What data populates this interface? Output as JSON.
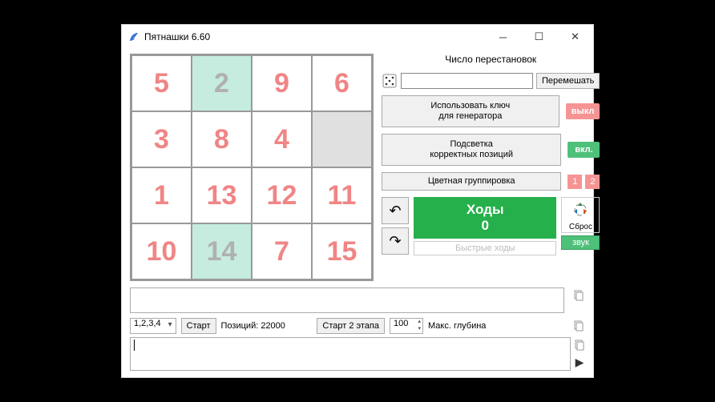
{
  "window": {
    "title": "Пятнашки 6.60"
  },
  "board": {
    "tiles": [
      {
        "v": "5",
        "cls": "red"
      },
      {
        "v": "2",
        "cls": "green-bg"
      },
      {
        "v": "9",
        "cls": "red"
      },
      {
        "v": "6",
        "cls": "red"
      },
      {
        "v": "3",
        "cls": "red"
      },
      {
        "v": "8",
        "cls": "red"
      },
      {
        "v": "4",
        "cls": "red"
      },
      {
        "v": "",
        "cls": "empty"
      },
      {
        "v": "1",
        "cls": "red"
      },
      {
        "v": "13",
        "cls": "red"
      },
      {
        "v": "12",
        "cls": "red"
      },
      {
        "v": "11",
        "cls": "red"
      },
      {
        "v": "10",
        "cls": "red"
      },
      {
        "v": "14",
        "cls": "green-bg"
      },
      {
        "v": "7",
        "cls": "red"
      },
      {
        "v": "15",
        "cls": "red"
      }
    ]
  },
  "rpanel": {
    "perm_label": "Число перестановок",
    "perm_value": "",
    "perm_placeholder": "",
    "shuffle_btn": "Перемешать",
    "use_key_btn": "Использовать ключ\nдля генератора",
    "off_label": "выкл",
    "highlight_btn": "Подсветка\nкорректных позиций",
    "on_label": "вкл.",
    "color_group_btn": "Цветная группировка",
    "group1": "1",
    "group2": "2",
    "moves_label": "Ходы",
    "moves_count": "0",
    "fast_moves": "Быстрые ходы",
    "reset_label": "Сброс",
    "sound_label": "звук"
  },
  "bottom": {
    "mode_select": "1,2,3,4",
    "start_btn": "Старт",
    "positions_label": "Позиций: 22000",
    "start2_btn": "Старт 2 этапа",
    "depth_val": "100",
    "depth_label": "Макс. глубина"
  }
}
